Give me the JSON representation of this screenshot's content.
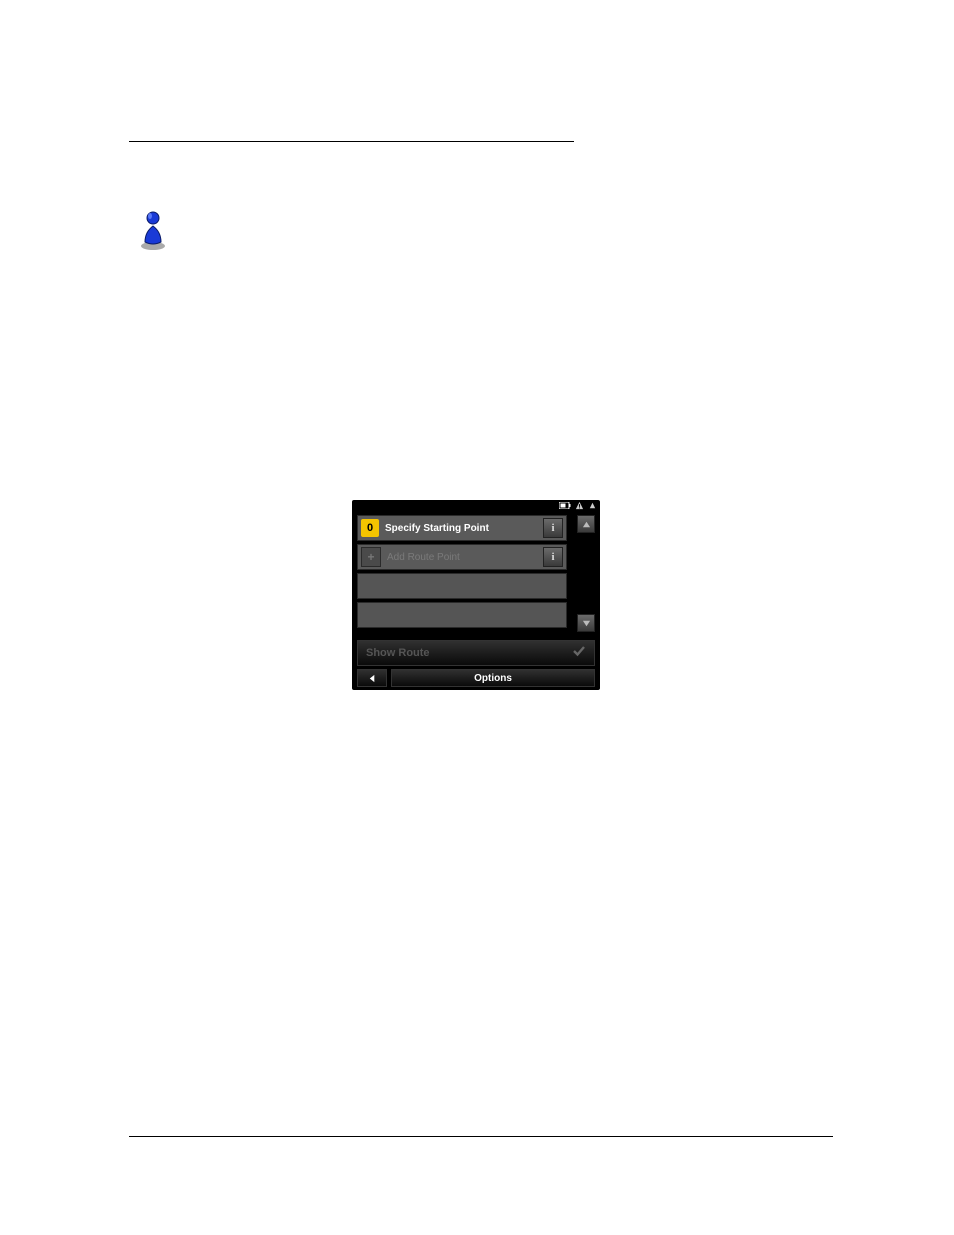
{
  "device": {
    "rows": [
      {
        "num": "0",
        "label": "Specify Starting Point",
        "kind": "start"
      },
      {
        "label": "Add Route Point",
        "kind": "add"
      }
    ],
    "show_route": "Show Route",
    "options": "Options"
  }
}
